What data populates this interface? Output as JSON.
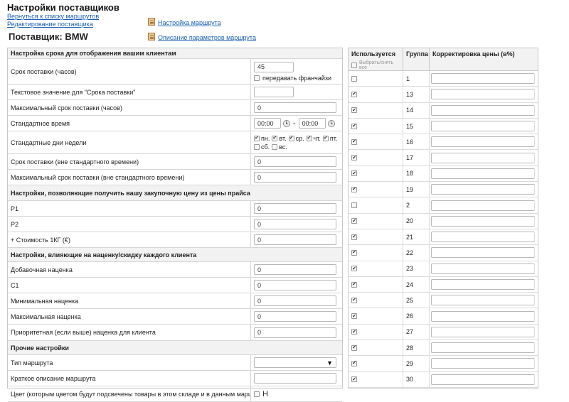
{
  "page": {
    "title": "Настройки поставщиков",
    "back_link": "Вернуться к списку маршрутов",
    "edit_link": "Редактирование поставщика",
    "route_settings_link": "Настройка  маршрута",
    "route_params_link": "Описание параметров маршрута",
    "supplier": "Поставщик: BMW"
  },
  "left": {
    "section1": "Настройка срока для отображения вашим клиентам",
    "delivery_time_label": "Срок поставки (часов)",
    "delivery_time_value": "45",
    "franchise_label": "передавать франчайзи",
    "text_value_label": "Текстовое значение для \"Срока поставки\"",
    "text_value": "",
    "max_delivery_label": "Максимальный срок поставки (часов)",
    "max_delivery_value": "0",
    "std_time_label": "Стандартное время",
    "std_time_from": "00:00",
    "std_time_dash": "-",
    "std_time_to": "00:00",
    "std_days_label": "Стандартные дни недели",
    "days": [
      {
        "label": "пн.",
        "checked": true
      },
      {
        "label": "вт.",
        "checked": true
      },
      {
        "label": "ср.",
        "checked": true
      },
      {
        "label": "чт.",
        "checked": true
      },
      {
        "label": "пт.",
        "checked": true
      },
      {
        "label": "сб.",
        "checked": false
      },
      {
        "label": "вс.",
        "checked": false
      }
    ],
    "nonstd_delivery_label": "Срок поставки (вне стандартного времени)",
    "nonstd_delivery_value": "0",
    "nonstd_max_label": "Максимальный срок поставки (вне стандартного времени)",
    "nonstd_max_value": "0",
    "section2": "Настройки, позволяющие получить вашу закупочную цену из цены прайса",
    "p1_label": "P1",
    "p1_value": "0",
    "p2_label": "P2",
    "p2_value": "0",
    "cost_label": "+ Стоимость 1КГ (€)",
    "cost_value": "0",
    "section3": "Настройки, влияющие на наценку/скидку каждого клиента",
    "extra_markup_label": "Добавочная наценка",
    "extra_markup_value": "0",
    "c1_label": "C1",
    "c1_value": "0",
    "min_markup_label": "Минимальная наценка",
    "min_markup_value": "0",
    "max_markup_label": "Максимальная наценка",
    "max_markup_value": "0",
    "priority_markup_label": "Приоритетная (если выше) наценка для клиента",
    "priority_markup_value": "0",
    "section4": "Прочие настройки",
    "route_type_label": "Тип маршрута",
    "route_type_value": "",
    "route_desc_label": "Краткое описание маршрута",
    "route_desc_value": "",
    "cut_label": "Цвет (которым цветом будут подсвечены товары в этом складе и в данным маршрутом)",
    "cut_value": "Н"
  },
  "right": {
    "col_used": "Используется",
    "select_all": "Выбрать/снять все",
    "col_group": "Группа",
    "col_price": "Корректировка цены (в%)",
    "rows": [
      {
        "group": "1",
        "checked": false,
        "price": ""
      },
      {
        "group": "13",
        "checked": true,
        "price": ""
      },
      {
        "group": "14",
        "checked": true,
        "price": ""
      },
      {
        "group": "15",
        "checked": true,
        "price": ""
      },
      {
        "group": "16",
        "checked": true,
        "price": ""
      },
      {
        "group": "17",
        "checked": true,
        "price": ""
      },
      {
        "group": "18",
        "checked": true,
        "price": ""
      },
      {
        "group": "19",
        "checked": true,
        "price": ""
      },
      {
        "group": "2",
        "checked": false,
        "price": ""
      },
      {
        "group": "20",
        "checked": true,
        "price": ""
      },
      {
        "group": "21",
        "checked": true,
        "price": ""
      },
      {
        "group": "22",
        "checked": true,
        "price": ""
      },
      {
        "group": "23",
        "checked": true,
        "price": ""
      },
      {
        "group": "24",
        "checked": true,
        "price": ""
      },
      {
        "group": "25",
        "checked": true,
        "price": ""
      },
      {
        "group": "26",
        "checked": true,
        "price": ""
      },
      {
        "group": "27",
        "checked": true,
        "price": ""
      },
      {
        "group": "28",
        "checked": true,
        "price": ""
      },
      {
        "group": "29",
        "checked": true,
        "price": ""
      },
      {
        "group": "30",
        "checked": true,
        "price": ""
      }
    ]
  },
  "icons": {
    "document": "document-icon",
    "clock": "clock-icon",
    "dropdown": "triangle-down-icon"
  }
}
